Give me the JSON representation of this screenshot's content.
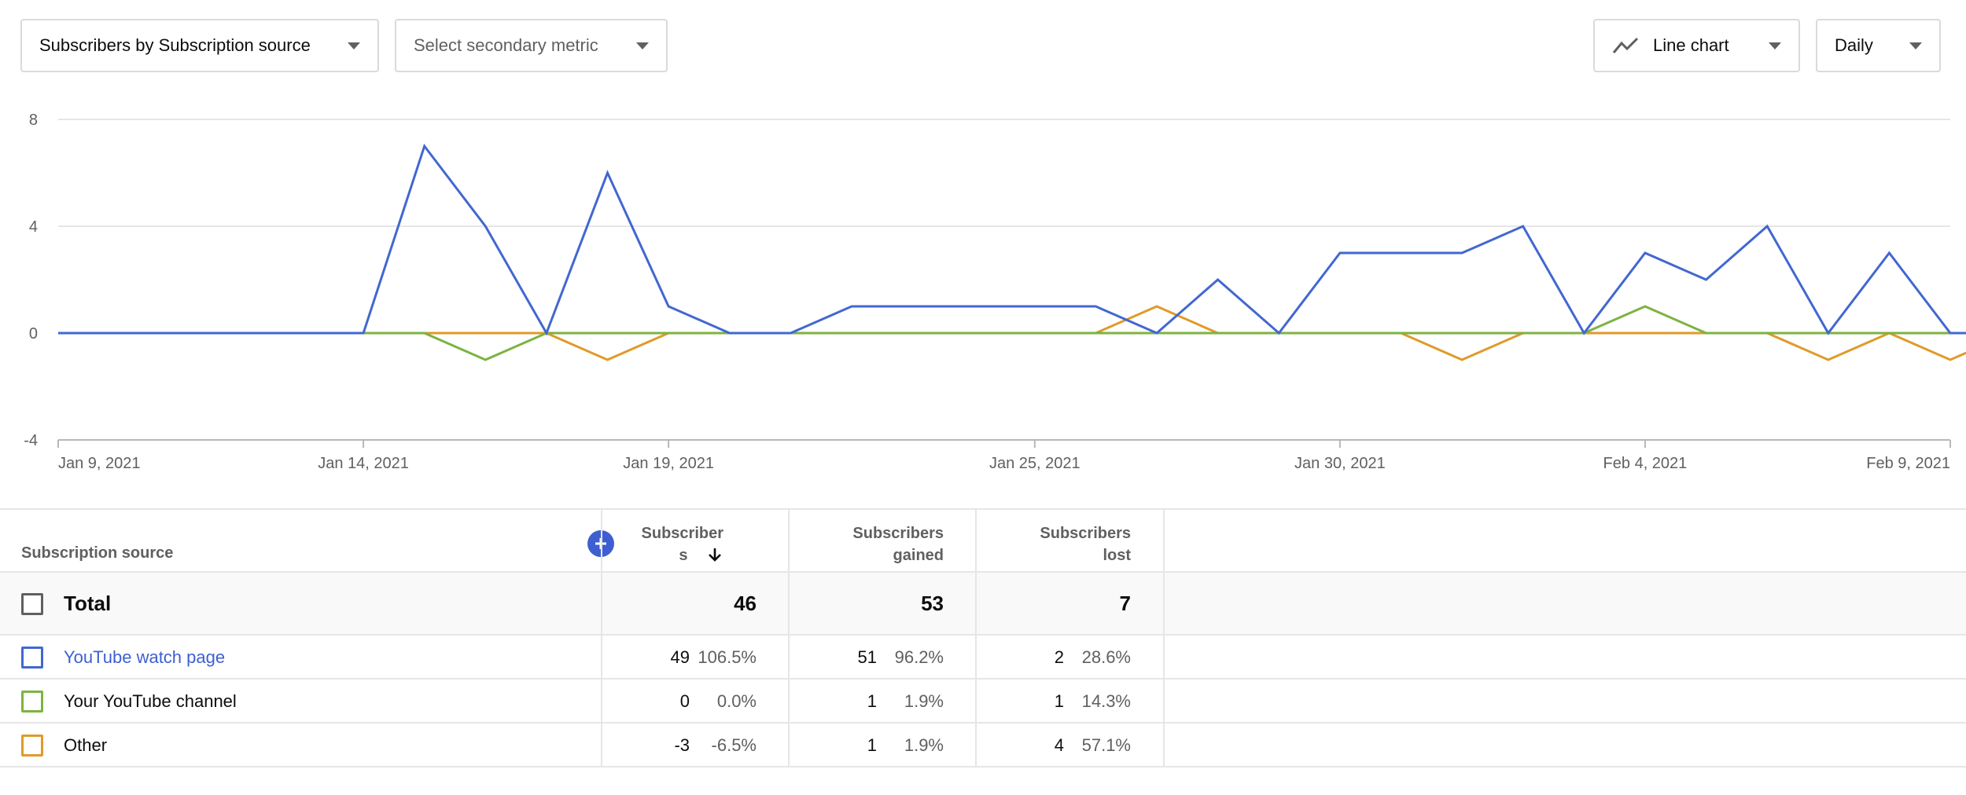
{
  "controls": {
    "metric_label": "Subscribers by Subscription source",
    "secondary_placeholder": "Select secondary metric",
    "chart_type_label": "Line chart",
    "interval_label": "Daily"
  },
  "chart_data": {
    "type": "line",
    "ylim": [
      -4,
      8
    ],
    "yticks": [
      "8",
      "4",
      "0",
      "-4"
    ],
    "x_start": "2021-01-09",
    "x_end": "2021-02-09",
    "xtick_labels": [
      "Jan 9, 2021",
      "Jan 14, 2021",
      "Jan 19, 2021",
      "Jan 25, 2021",
      "Jan 30, 2021",
      "Feb 4, 2021",
      "Feb 9, 2021"
    ],
    "xtick_dates": [
      "2021-01-09",
      "2021-01-14",
      "2021-01-19",
      "2021-01-25",
      "2021-01-30",
      "2021-02-04",
      "2021-02-09"
    ],
    "series": [
      {
        "color": "#4267d0",
        "values": [
          0,
          0,
          0,
          0,
          0,
          0,
          7,
          4,
          0,
          6,
          1,
          0,
          0,
          1,
          1,
          1,
          1,
          1,
          0,
          2,
          0,
          3,
          3,
          3,
          4,
          0,
          3,
          2,
          4,
          0,
          3,
          0,
          0
        ]
      },
      {
        "color": "#7cb342",
        "values": [
          0,
          0,
          0,
          0,
          0,
          0,
          0,
          -1,
          0,
          0,
          0,
          0,
          0,
          0,
          0,
          0,
          0,
          0,
          0,
          0,
          0,
          0,
          0,
          0,
          0,
          0,
          1,
          0,
          0,
          0,
          0,
          0,
          0
        ]
      },
      {
        "color": "#e09a2a",
        "values": [
          0,
          0,
          0,
          0,
          0,
          0,
          0,
          0,
          0,
          -1,
          0,
          0,
          0,
          0,
          0,
          0,
          0,
          0,
          1,
          0,
          0,
          0,
          0,
          -1,
          0,
          0,
          0,
          0,
          0,
          -1,
          0,
          -1,
          0
        ]
      }
    ]
  },
  "table": {
    "header": {
      "source": "Subscription source",
      "col1_line1": "Subscriber",
      "col1_line2": "s",
      "col2_line1": "Subscribers",
      "col2_line2": "gained",
      "col3_line1": "Subscribers",
      "col3_line2": "lost"
    },
    "total": {
      "label": "Total",
      "subscribers": "46",
      "gained": "53",
      "lost": "7"
    },
    "rows": [
      {
        "label": "YouTube watch page",
        "color": "#4267d0",
        "subs": "49",
        "subs_pct": "106.5%",
        "gained": "51",
        "gained_pct": "96.2%",
        "lost": "2",
        "lost_pct": "28.6%"
      },
      {
        "label": "Your YouTube channel",
        "color": "#7cb342",
        "subs": "0",
        "subs_pct": "0.0%",
        "gained": "1",
        "gained_pct": "1.9%",
        "lost": "1",
        "lost_pct": "14.3%"
      },
      {
        "label": "Other",
        "color": "#e09a2a",
        "subs": "-3",
        "subs_pct": "-6.5%",
        "gained": "1",
        "gained_pct": "1.9%",
        "lost": "4",
        "lost_pct": "57.1%"
      }
    ]
  }
}
